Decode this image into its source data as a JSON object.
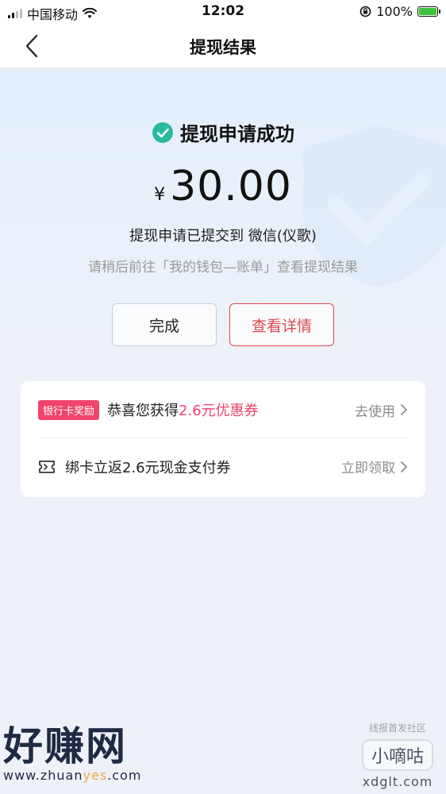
{
  "status_bar": {
    "carrier": "中国移动",
    "time": "12:02",
    "battery_percent": "100%",
    "battery_level": 1.0,
    "icons": [
      "signal-icon",
      "wifi-icon",
      "orientation-lock-icon",
      "battery-charging-icon"
    ]
  },
  "nav": {
    "title": "提现结果",
    "back_icon": "chevron-left-icon"
  },
  "result": {
    "status_title": "提现申请成功",
    "status_icon": "check-circle-icon",
    "status_color": "#2bb8a0",
    "currency": "¥",
    "amount": "30.00",
    "submitted_text": "提现申请已提交到 微信(仪歌)",
    "hint_text": "请稍后前往「我的钱包—账单」查看提现结果"
  },
  "buttons": {
    "done_label": "完成",
    "detail_label": "查看详情",
    "accent_color": "#e0484f"
  },
  "rewards": {
    "row1": {
      "badge": "银行卡奖励",
      "text": "恭喜您获得 ",
      "highlight": "2.6元优惠券",
      "action": "去使用"
    },
    "row2": {
      "icon": "ticket-icon",
      "text": "绑卡立返2.6元现金支付券",
      "action": "立即领取"
    },
    "badge_color": "#f0446a"
  },
  "watermarks": {
    "left_big": "好赚网",
    "left_url_prefix": "www.zhuan",
    "left_url_accent": "yes",
    "left_url_suffix": ".com",
    "right_small": "线报首发社区",
    "right_box": "小嘀咕",
    "right_url": "xdglt.com"
  }
}
